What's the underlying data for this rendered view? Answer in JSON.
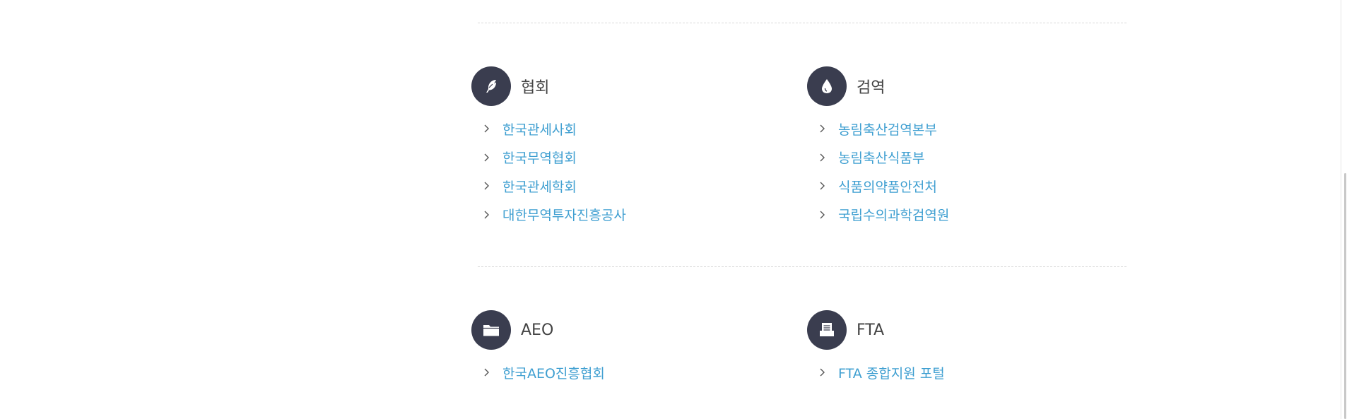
{
  "sections": [
    {
      "title": "협회",
      "icon": "feather-icon",
      "links": [
        "한국관세사회",
        "한국무역협회",
        "한국관세학회",
        "대한무역투자진흥공사"
      ]
    },
    {
      "title": "검역",
      "icon": "drop-icon",
      "links": [
        "농림축산검역본부",
        "농림축산식품부",
        "식품의약품안전처",
        "국립수의과학검역원"
      ]
    },
    {
      "title": "AEO",
      "icon": "folder-icon",
      "links": [
        "한국AEO진흥협회"
      ]
    },
    {
      "title": "FTA",
      "icon": "document-tray-icon",
      "links": [
        "FTA 종합지원 포털"
      ]
    }
  ],
  "colors": {
    "icon_circle": "#3a3d4f",
    "link": "#3f9fd1",
    "heading": "#444444",
    "divider": "#d9d9d9"
  }
}
